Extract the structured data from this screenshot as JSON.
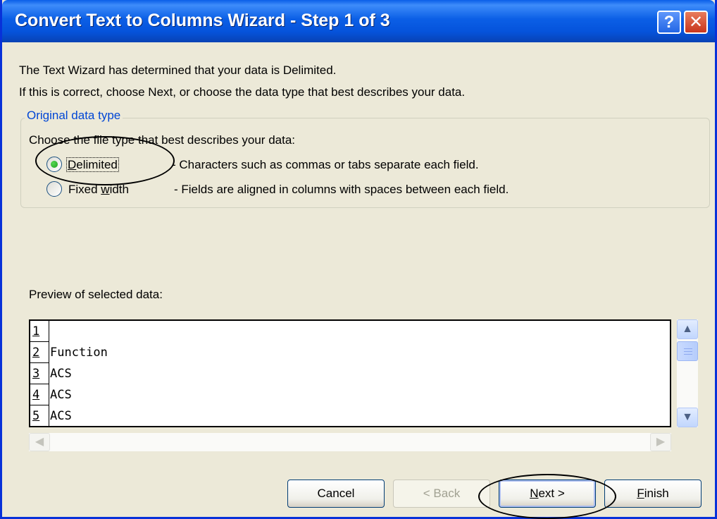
{
  "window": {
    "title": "Convert Text to Columns Wizard - Step 1 of 3",
    "help_label": "?",
    "close_label": "✕"
  },
  "intro": {
    "line1": "The Text Wizard has determined that your data is Delimited.",
    "line2": "If this is correct, choose Next, or choose the data type that best describes your data."
  },
  "original_data_type": {
    "legend": "Original data type",
    "prompt": "Choose the file type that best describes your data:",
    "options": [
      {
        "label_pre": "",
        "label_ul": "D",
        "label_post": "elimited",
        "description": "- Characters such as commas or tabs separate each field.",
        "selected": true
      },
      {
        "label_pre": "Fixed ",
        "label_ul": "w",
        "label_post": "idth",
        "description": "- Fields are aligned in columns with spaces between each field.",
        "selected": false
      }
    ]
  },
  "preview": {
    "label": "Preview of selected data:",
    "rows": [
      {
        "num": "1",
        "value": ""
      },
      {
        "num": "2",
        "value": "Function"
      },
      {
        "num": "3",
        "value": "ACS"
      },
      {
        "num": "4",
        "value": "ACS"
      },
      {
        "num": "5",
        "value": "ACS"
      }
    ]
  },
  "scroll_icons": {
    "up": "▲",
    "down": "▼",
    "left": "◀",
    "right": "▶"
  },
  "buttons": {
    "cancel": "Cancel",
    "back": "< Back",
    "next_ul": "N",
    "next_rest": "ext >",
    "finish_ul": "F",
    "finish_rest": "inish"
  }
}
